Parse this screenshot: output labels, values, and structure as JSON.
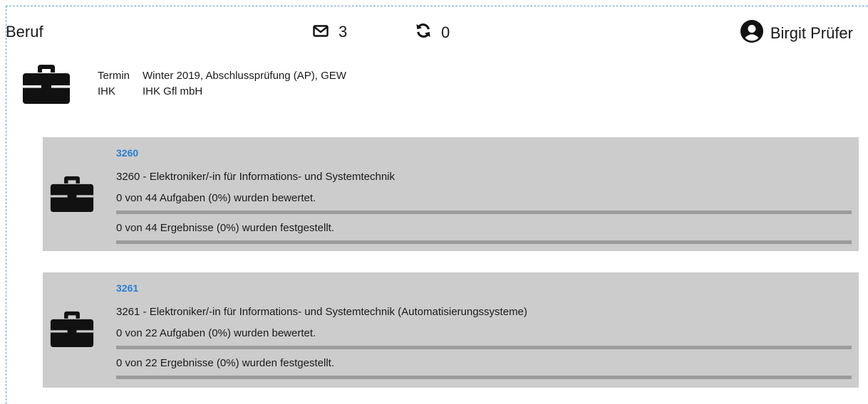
{
  "header": {
    "title": "Beruf",
    "mail_count": "3",
    "sync_count": "0",
    "user_name": "Birgit Prüfer"
  },
  "meta": {
    "termin_label": "Termin",
    "termin_value": "Winter 2019, Abschlussprüfung (AP), GEW",
    "ihk_label": "IHK",
    "ihk_value": "IHK Gfl mbH"
  },
  "cards": [
    {
      "code": "3260",
      "name": "3260 - Elektroniker/-in für Informations- und Systemtechnik",
      "tasks_text": "0 von 44 Aufgaben (0%) wurden bewertet.",
      "tasks_progress": 0,
      "results_text": "0 von 44 Ergebnisse (0%) wurden festgestellt.",
      "results_progress": 0
    },
    {
      "code": "3261",
      "name": "3261 - Elektroniker/-in für Informations- und Systemtechnik (Automatisierungssysteme)",
      "tasks_text": "0 von 22 Aufgaben (0%) wurden bewertet.",
      "tasks_progress": 0,
      "results_text": "0 von 22 Ergebnisse (0%) wurden festgestellt.",
      "results_progress": 0
    }
  ],
  "colors": {
    "accent": "#2a7fd0",
    "card_bg": "#cccccc",
    "bar_bg": "#9c9c9c",
    "frame_dash": "#6c9bc8"
  },
  "icons": [
    "envelope-icon",
    "sync-icon",
    "user-circle-icon",
    "briefcase-icon"
  ]
}
